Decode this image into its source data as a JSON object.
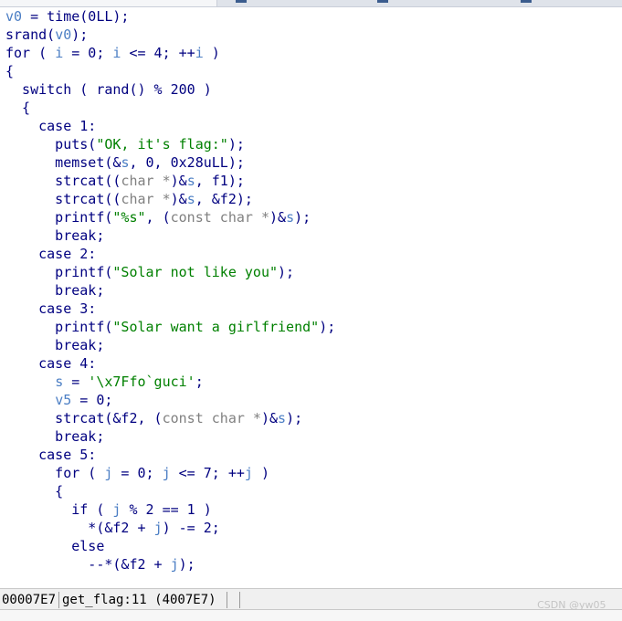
{
  "window": {
    "accent_color": "#3b5c8e"
  },
  "code_lines": [
    [
      {
        "t": "v0",
        "c": "var"
      },
      {
        "t": " = time(0LL);",
        "c": "plain"
      }
    ],
    [
      {
        "t": "srand(",
        "c": "plain"
      },
      {
        "t": "v0",
        "c": "var"
      },
      {
        "t": ");",
        "c": "plain"
      }
    ],
    [
      {
        "t": "for ( ",
        "c": "plain"
      },
      {
        "t": "i",
        "c": "var"
      },
      {
        "t": " = 0; ",
        "c": "plain"
      },
      {
        "t": "i",
        "c": "var"
      },
      {
        "t": " <= 4; ++",
        "c": "plain"
      },
      {
        "t": "i",
        "c": "var"
      },
      {
        "t": " )",
        "c": "plain"
      }
    ],
    [
      {
        "t": "{",
        "c": "plain"
      }
    ],
    [
      {
        "t": "  switch ( rand() % 200 )",
        "c": "plain"
      }
    ],
    [
      {
        "t": "  {",
        "c": "plain"
      }
    ],
    [
      {
        "t": "    case 1:",
        "c": "plain"
      }
    ],
    [
      {
        "t": "      puts(",
        "c": "plain"
      },
      {
        "t": "\"OK, it's flag:\"",
        "c": "str"
      },
      {
        "t": ");",
        "c": "plain"
      }
    ],
    [
      {
        "t": "      memset(&",
        "c": "plain"
      },
      {
        "t": "s",
        "c": "var"
      },
      {
        "t": ", 0, 0x28uLL);",
        "c": "plain"
      }
    ],
    [
      {
        "t": "      strcat((",
        "c": "plain"
      },
      {
        "t": "char *",
        "c": "type"
      },
      {
        "t": ")&",
        "c": "plain"
      },
      {
        "t": "s",
        "c": "var"
      },
      {
        "t": ", f1);",
        "c": "plain"
      }
    ],
    [
      {
        "t": "      strcat((",
        "c": "plain"
      },
      {
        "t": "char *",
        "c": "type"
      },
      {
        "t": ")&",
        "c": "plain"
      },
      {
        "t": "s",
        "c": "var"
      },
      {
        "t": ", &f2);",
        "c": "plain"
      }
    ],
    [
      {
        "t": "      printf(",
        "c": "plain"
      },
      {
        "t": "\"%s\"",
        "c": "str"
      },
      {
        "t": ", (",
        "c": "plain"
      },
      {
        "t": "const char *",
        "c": "type"
      },
      {
        "t": ")&",
        "c": "plain"
      },
      {
        "t": "s",
        "c": "var"
      },
      {
        "t": ");",
        "c": "plain"
      }
    ],
    [
      {
        "t": "      break;",
        "c": "plain"
      }
    ],
    [
      {
        "t": "    case 2:",
        "c": "plain"
      }
    ],
    [
      {
        "t": "      printf(",
        "c": "plain"
      },
      {
        "t": "\"Solar not like you\"",
        "c": "str"
      },
      {
        "t": ");",
        "c": "plain"
      }
    ],
    [
      {
        "t": "      break;",
        "c": "plain"
      }
    ],
    [
      {
        "t": "    case 3:",
        "c": "plain"
      }
    ],
    [
      {
        "t": "      printf(",
        "c": "plain"
      },
      {
        "t": "\"Solar want a girlfriend\"",
        "c": "str"
      },
      {
        "t": ");",
        "c": "plain"
      }
    ],
    [
      {
        "t": "      break;",
        "c": "plain"
      }
    ],
    [
      {
        "t": "    case 4:",
        "c": "plain"
      }
    ],
    [
      {
        "t": "      ",
        "c": "plain"
      },
      {
        "t": "s",
        "c": "var"
      },
      {
        "t": " = ",
        "c": "plain"
      },
      {
        "t": "'\\x7Ffo`guci'",
        "c": "str"
      },
      {
        "t": ";",
        "c": "plain"
      }
    ],
    [
      {
        "t": "      ",
        "c": "plain"
      },
      {
        "t": "v5",
        "c": "var"
      },
      {
        "t": " = 0;",
        "c": "plain"
      }
    ],
    [
      {
        "t": "      strcat(&f2, (",
        "c": "plain"
      },
      {
        "t": "const char *",
        "c": "type"
      },
      {
        "t": ")&",
        "c": "plain"
      },
      {
        "t": "s",
        "c": "var"
      },
      {
        "t": ");",
        "c": "plain"
      }
    ],
    [
      {
        "t": "      break;",
        "c": "plain"
      }
    ],
    [
      {
        "t": "    case 5:",
        "c": "plain"
      }
    ],
    [
      {
        "t": "      for ( ",
        "c": "plain"
      },
      {
        "t": "j",
        "c": "var"
      },
      {
        "t": " = 0; ",
        "c": "plain"
      },
      {
        "t": "j",
        "c": "var"
      },
      {
        "t": " <= 7; ++",
        "c": "plain"
      },
      {
        "t": "j",
        "c": "var"
      },
      {
        "t": " )",
        "c": "plain"
      }
    ],
    [
      {
        "t": "      {",
        "c": "plain"
      }
    ],
    [
      {
        "t": "        if ( ",
        "c": "plain"
      },
      {
        "t": "j",
        "c": "var"
      },
      {
        "t": " % 2 == 1 )",
        "c": "plain"
      }
    ],
    [
      {
        "t": "          *(&f2 + ",
        "c": "plain"
      },
      {
        "t": "j",
        "c": "var"
      },
      {
        "t": ") -= 2;",
        "c": "plain"
      }
    ],
    [
      {
        "t": "        else",
        "c": "plain"
      }
    ],
    [
      {
        "t": "          --*(&f2 + ",
        "c": "plain"
      },
      {
        "t": "j",
        "c": "var"
      },
      {
        "t": ");",
        "c": "plain"
      }
    ]
  ],
  "status_bar": {
    "address": "00007E7",
    "location": "get_flag:11 (4007E7)"
  },
  "watermark": "CSDN @yw05_"
}
